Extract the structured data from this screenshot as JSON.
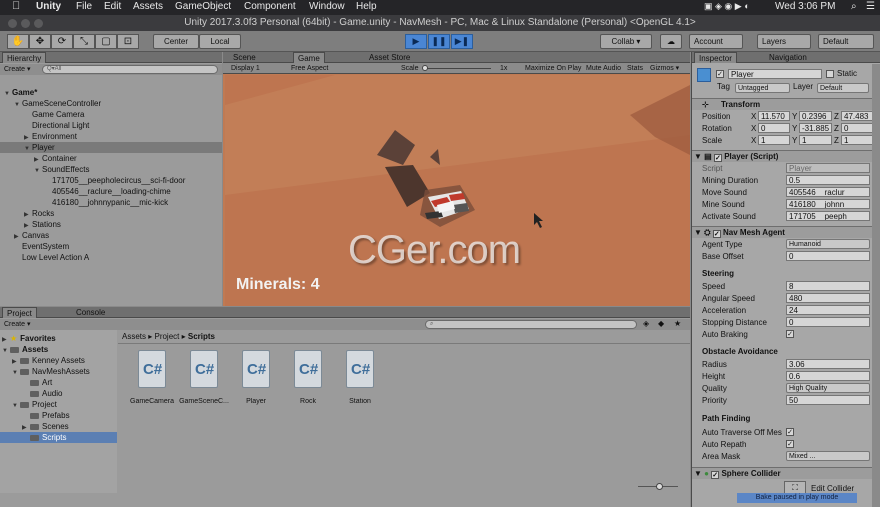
{
  "menubar": {
    "app": "Unity",
    "items": [
      "File",
      "Edit",
      "Assets",
      "GameObject",
      "Component",
      "Window",
      "Help"
    ],
    "time": "Wed 3:06 PM"
  },
  "window": {
    "title": "Unity 2017.3.0f3 Personal (64bit) - Game.unity - NavMesh - PC, Mac & Linux Standalone (Personal) <OpenGL 4.1>"
  },
  "toolbar": {
    "pivot": "Center",
    "space": "Local",
    "collab": "Collab ▾",
    "account": "Account",
    "layers": "Layers",
    "layout": "Default"
  },
  "hierarchy": {
    "tab": "Hierarchy",
    "create": "Create ▾",
    "search_placeholder": "Q▾All",
    "rows": [
      {
        "label": "Game*",
        "indent": 0,
        "arrow": "▼",
        "bold": true
      },
      {
        "label": "GameSceneController",
        "indent": 1,
        "arrow": "▼"
      },
      {
        "label": "Game Camera",
        "indent": 2,
        "arrow": ""
      },
      {
        "label": "Directional Light",
        "indent": 2,
        "arrow": ""
      },
      {
        "label": "Environment",
        "indent": 2,
        "arrow": "▶"
      },
      {
        "label": "Player",
        "indent": 2,
        "arrow": "▼",
        "selected": true
      },
      {
        "label": "Container",
        "indent": 3,
        "arrow": "▶"
      },
      {
        "label": "SoundEffects",
        "indent": 3,
        "arrow": "▼"
      },
      {
        "label": "171705__peepholecircus__sci-fi-door",
        "indent": 4,
        "arrow": ""
      },
      {
        "label": "405546__raclure__loading-chime",
        "indent": 4,
        "arrow": ""
      },
      {
        "label": "416180__johnnypanic__mic-kick",
        "indent": 4,
        "arrow": ""
      },
      {
        "label": "Rocks",
        "indent": 2,
        "arrow": "▶"
      },
      {
        "label": "Stations",
        "indent": 2,
        "arrow": "▶"
      },
      {
        "label": "Canvas",
        "indent": 1,
        "arrow": "▶"
      },
      {
        "label": "EventSystem",
        "indent": 1,
        "arrow": ""
      },
      {
        "label": "Low Level Action A",
        "indent": 1,
        "arrow": ""
      }
    ]
  },
  "game": {
    "tabs": [
      "Scene",
      "Game",
      "Asset Store"
    ],
    "display": "Display 1",
    "aspect": "Free Aspect",
    "scale_label": "Scale",
    "scale_value": "1x",
    "buttons": [
      "Maximize On Play",
      "Mute Audio",
      "Stats",
      "Gizmos ▾"
    ],
    "minerals": "Minerals: 4",
    "watermark": "CGer.com"
  },
  "project": {
    "tabs": [
      "Project",
      "Console"
    ],
    "create": "Create ▾",
    "breadcrumb": [
      "Assets",
      "Project",
      "Scripts"
    ],
    "tree": [
      {
        "label": "Favorites",
        "indent": 0,
        "arrow": "▶",
        "bold": true,
        "star": true
      },
      {
        "label": "Assets",
        "indent": 0,
        "arrow": "▼",
        "bold": true
      },
      {
        "label": "Kenney Assets",
        "indent": 1,
        "arrow": "▶"
      },
      {
        "label": "NavMeshAssets",
        "indent": 1,
        "arrow": "▼"
      },
      {
        "label": "Art",
        "indent": 2,
        "arrow": ""
      },
      {
        "label": "Audio",
        "indent": 2,
        "arrow": ""
      },
      {
        "label": "Project",
        "indent": 1,
        "arrow": "▼"
      },
      {
        "label": "Prefabs",
        "indent": 2,
        "arrow": ""
      },
      {
        "label": "Scenes",
        "indent": 2,
        "arrow": "▶"
      },
      {
        "label": "Scripts",
        "indent": 2,
        "arrow": "",
        "selected": true
      }
    ],
    "assets": [
      "GameCamera",
      "GameSceneC...",
      "Player",
      "Rock",
      "Station"
    ]
  },
  "inspector": {
    "tabs": [
      "Inspector",
      "Navigation"
    ],
    "object_name": "Player",
    "static": "Static",
    "tag_label": "Tag",
    "tag": "Untagged",
    "layer_label": "Layer",
    "layer": "Default",
    "transform": {
      "title": "Transform",
      "position": {
        "label": "Position",
        "x": "11.570",
        "y": "0.2396",
        "z": "47.483"
      },
      "rotation": {
        "label": "Rotation",
        "x": "0",
        "y": "-31.885",
        "z": "0"
      },
      "scale": {
        "label": "Scale",
        "x": "1",
        "y": "1",
        "z": "1"
      }
    },
    "player": {
      "title": "Player (Script)",
      "script_label": "Script",
      "script": "Player",
      "mining_label": "Mining Duration",
      "mining": "0.5",
      "move_label": "Move Sound",
      "move": "405546__raclur",
      "mine_label": "Mine Sound",
      "mine": "416180__johnn",
      "activate_label": "Activate Sound",
      "activate": "171705__peeph"
    },
    "nav": {
      "title": "Nav Mesh Agent",
      "agent_type_label": "Agent Type",
      "agent_type": "Humanoid",
      "base_offset_label": "Base Offset",
      "base_offset": "0",
      "steering": "Steering",
      "speed_label": "Speed",
      "speed": "8",
      "angular_label": "Angular Speed",
      "angular": "480",
      "accel_label": "Acceleration",
      "accel": "24",
      "stopping_label": "Stopping Distance",
      "stopping": "0",
      "braking_label": "Auto Braking",
      "avoidance": "Obstacle Avoidance",
      "radius_label": "Radius",
      "radius": "3.06",
      "height_label": "Height",
      "height": "0.6",
      "quality_label": "Quality",
      "quality": "High Quality",
      "priority_label": "Priority",
      "priority": "50",
      "pathfinding": "Path Finding",
      "traverse_label": "Auto Traverse Off Mes",
      "repath_label": "Auto Repath",
      "area_label": "Area Mask",
      "area": "Mixed ..."
    },
    "sphere": {
      "title": "Sphere Collider",
      "edit": "Edit Collider"
    },
    "status": "Bake paused in play mode"
  },
  "colors": {
    "accent": "#4a86d4",
    "terrain": "#be7550",
    "panel": "#9b9b9b"
  }
}
